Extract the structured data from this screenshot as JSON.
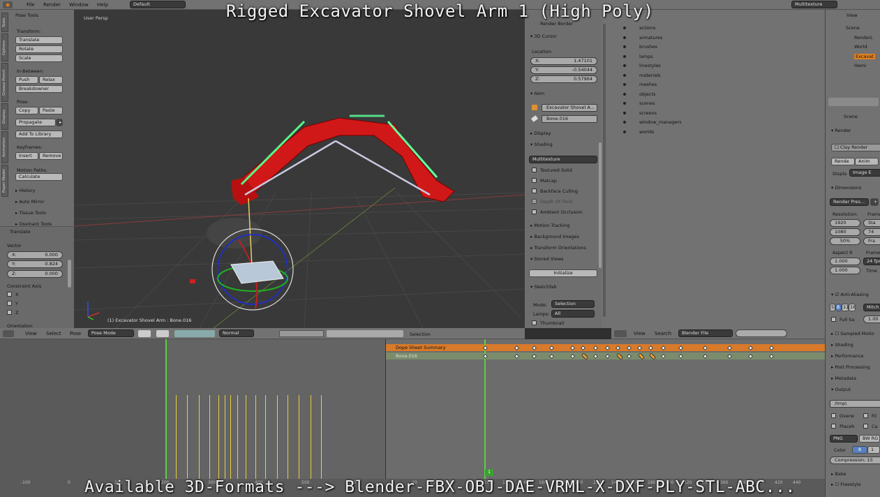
{
  "overlay": {
    "title": "Rigged Excavator Shovel Arm 1 (High Poly)",
    "footer": "Available 3D-Formats ---> Blender-FBX-OBJ-DAE-VRML-X-DXF-PLY-STL-ABC..."
  },
  "topbar": {
    "menus": [
      "File",
      "Render",
      "Window",
      "Help"
    ],
    "layout": "Default",
    "texture_mode": "Multitexture"
  },
  "viewport": {
    "label": "User Persp",
    "object_info": "(1) Excavator Shovel Arm : Bone.016",
    "header": {
      "menus": [
        "View",
        "Select",
        "Pose"
      ],
      "mode": "Pose Mode",
      "pivot": "Normal"
    }
  },
  "tool_shelf": {
    "title": "Pose Tools",
    "transform_label": "Transform:",
    "transform_buttons": [
      "Translate",
      "Rotate",
      "Scale"
    ],
    "inbetween_label": "In-Between:",
    "push": "Push",
    "relax": "Relax",
    "breakdowner": "Breakdowner",
    "pose_label": "Pose:",
    "copy": "Copy",
    "paste": "Paste",
    "propagate": "Propagate",
    "add_library": "Add To Library",
    "keyframes_label": "Keyframes:",
    "insert": "Insert",
    "remove": "Remove",
    "motion_label": "Motion Paths:",
    "calculate": "Calculate",
    "collapsed": [
      "History",
      "Auto Mirror",
      "Tissue Tools",
      "Ossmant Tools"
    ],
    "tabs": [
      "Tools",
      "Options",
      "Grease Pencil",
      "Display",
      "Animation",
      "Paper Model"
    ]
  },
  "operator": {
    "title": "Translate",
    "vector_label": "Vector",
    "x_label": "X:",
    "x": "0.000",
    "y_label": "Y:",
    "y": "0.824",
    "z_label": "Z:",
    "z": "0.000",
    "constraint_label": "Constraint Axis",
    "axes": [
      "X",
      "Y",
      "Z"
    ],
    "orientation_label": "Orientation"
  },
  "properties_n": {
    "render_border": "Render Border",
    "cursor_title": "3D Cursor",
    "location_label": "Location:",
    "x_label": "X:",
    "x": "1.47101",
    "y_label": "Y:",
    "y": "-0.54044",
    "z_label": "Z:",
    "z": "0.57964",
    "item_title": "Item",
    "item_name": "Excavator Shovel A...",
    "bone_name": "Bone.016",
    "display_title": "Display",
    "shading_title": "Shading",
    "shading_mode": "Multitexture",
    "shading_options": [
      "Textured Solid",
      "Matcap",
      "Backface Culling",
      "Depth Of Field",
      "Ambient Occlusion"
    ],
    "motion_tracking": "Motion Tracking",
    "background_images": "Background Images",
    "transform_orientations": "Transform Orientations",
    "stored_views": "Stored Views",
    "initialize": "Initialize",
    "sketchfab": "Sketchfab",
    "mode_label": "Mode:",
    "mode_value": "Selection",
    "lamps_label": "Lamps:",
    "lamps_value": "All",
    "thumbnail": "Thumbnail"
  },
  "outliner": {
    "items": [
      "actions",
      "armatures",
      "brushes",
      "lamps",
      "linestyles",
      "materials",
      "meshes",
      "objects",
      "scenes",
      "screens",
      "window_managers",
      "worlds"
    ],
    "tree": [
      "Scene",
      "RenderL",
      "World",
      "Excavat",
      "Hemi"
    ],
    "header": {
      "view": "View",
      "search": "Search",
      "mode": "Blender File"
    }
  },
  "render_props": {
    "scene": "Scene",
    "render_title": "Render",
    "clay_render": "Clay Render",
    "render_btn": "Rende",
    "anim_btn": "Anim",
    "display_label": "Displa",
    "display_value": "Image E",
    "dimensions_title": "Dimensions",
    "render_presets": "Render Pres...",
    "resolution_label": "Resolution:",
    "frame_label": "Frame",
    "res_x": "1920",
    "res_y": "1080",
    "res_pct": "50%",
    "start": "Sta",
    "end": "74",
    "frame_rate_short": "Fra",
    "aspect_label": "Aspect R",
    "aspect_x": "1.000",
    "aspect_y": "1.000",
    "frame_rate_label": "Frame",
    "fps": "24 fps",
    "time_label": "Time",
    "anti_alias": "Anti-Aliasing",
    "aa_samples": [
      "5",
      "8",
      "11",
      "16"
    ],
    "mitchell": "Mitch",
    "full_sample": "Full Sa",
    "full_val": "1.00",
    "sampled_motion": "Sampled Motio",
    "shading": "Shading",
    "performance": "Performance",
    "post_processing": "Post Processing",
    "metadata": "Metadata",
    "output": "Output",
    "output_path": "/tmp\\",
    "overwrite": "Overw",
    "file_ext": "Fil",
    "placeholders": "Placeh",
    "cache": "Ca",
    "format": "PNG",
    "color_mode": "BW RG",
    "color_label": "Color",
    "depth": "8",
    "depth2": "1",
    "compression": "Compression: 15",
    "bake": "Bake",
    "freestyle": "Freestyle"
  },
  "dopesheet": {
    "summary": "Dope Sheet Summary",
    "channel": "Bone.016",
    "current_frame": "1",
    "ruler": [
      "20",
      "40",
      "60",
      "80",
      "100",
      "120",
      "140",
      "160",
      "180",
      "200",
      "220",
      "240",
      "260",
      "280",
      "300",
      "320",
      "340",
      "360",
      "380",
      "400",
      "420",
      "440"
    ],
    "left_ruler": [
      "-100",
      "0",
      "100",
      "200",
      "300",
      "400",
      "500",
      "600"
    ]
  },
  "timeline_header": {
    "selection": "Selection"
  }
}
